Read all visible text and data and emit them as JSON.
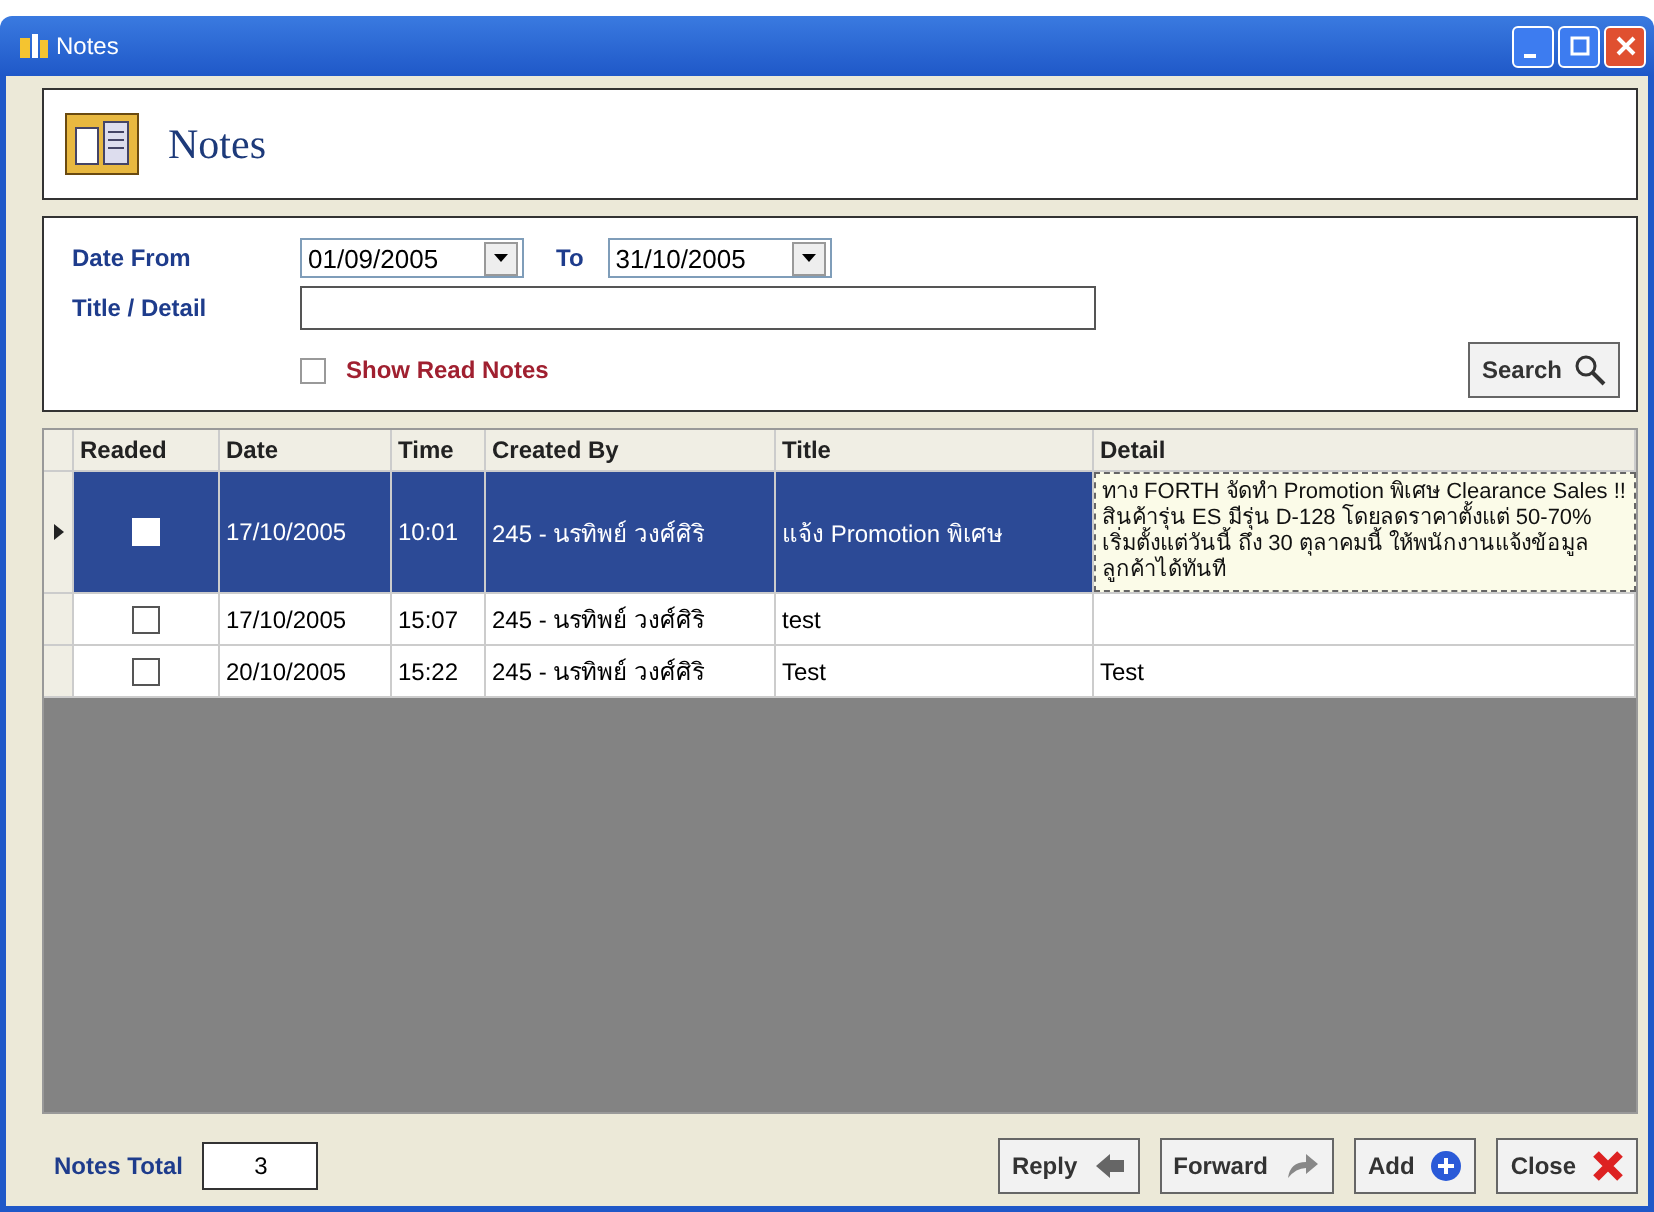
{
  "window": {
    "title": "Notes"
  },
  "header": {
    "title": "Notes"
  },
  "filter": {
    "date_from_label": "Date From",
    "date_from": "01/09/2005",
    "to_label": "To",
    "date_to": "31/10/2005",
    "title_detail_label": "Title / Detail",
    "show_read": {
      "label": "Show Read Notes",
      "checked": false
    },
    "search_button": "Search"
  },
  "table": {
    "columns": [
      "Readed",
      "Date",
      "Time",
      "Created By",
      "Title",
      "Detail"
    ],
    "rows": [
      {
        "selected": true,
        "readed": false,
        "date": "17/10/2005",
        "time": "10:01",
        "created_by": "245 - นรทิพย์ วงศ์ศิริ",
        "title": "แจ้ง Promotion พิเศษ",
        "detail": "ทาง FORTH จัดทำ Promotion พิเศษ Clearance Sales !! สินค้ารุ่น ES มีรุ่น D-128 โดยลดราคาตั้งแต่ 50-70% เริ่มตั้งแต่วันนี้ ถึง 30 ตุลาคมนี้ ให้พนักงานแจ้งข้อมูลลูกค้าได้ทันที"
      },
      {
        "selected": false,
        "readed": false,
        "date": "17/10/2005",
        "time": "15:07",
        "created_by": "245 - นรทิพย์ วงศ์ศิริ",
        "title": "test"
      },
      {
        "selected": false,
        "readed": false,
        "date": "20/10/2005",
        "time": "15:22",
        "created_by": "245 - นรทิพย์ วงศ์ศิริ",
        "title": "Test",
        "detail": "Test"
      }
    ]
  },
  "footer": {
    "total_label": "Notes Total",
    "total": "3",
    "buttons": [
      {
        "label": "Reply",
        "kind": "reply"
      },
      {
        "label": "Forward",
        "kind": "forward"
      },
      {
        "label": "Add",
        "kind": "add"
      },
      {
        "label": "Close",
        "kind": "close"
      }
    ]
  }
}
